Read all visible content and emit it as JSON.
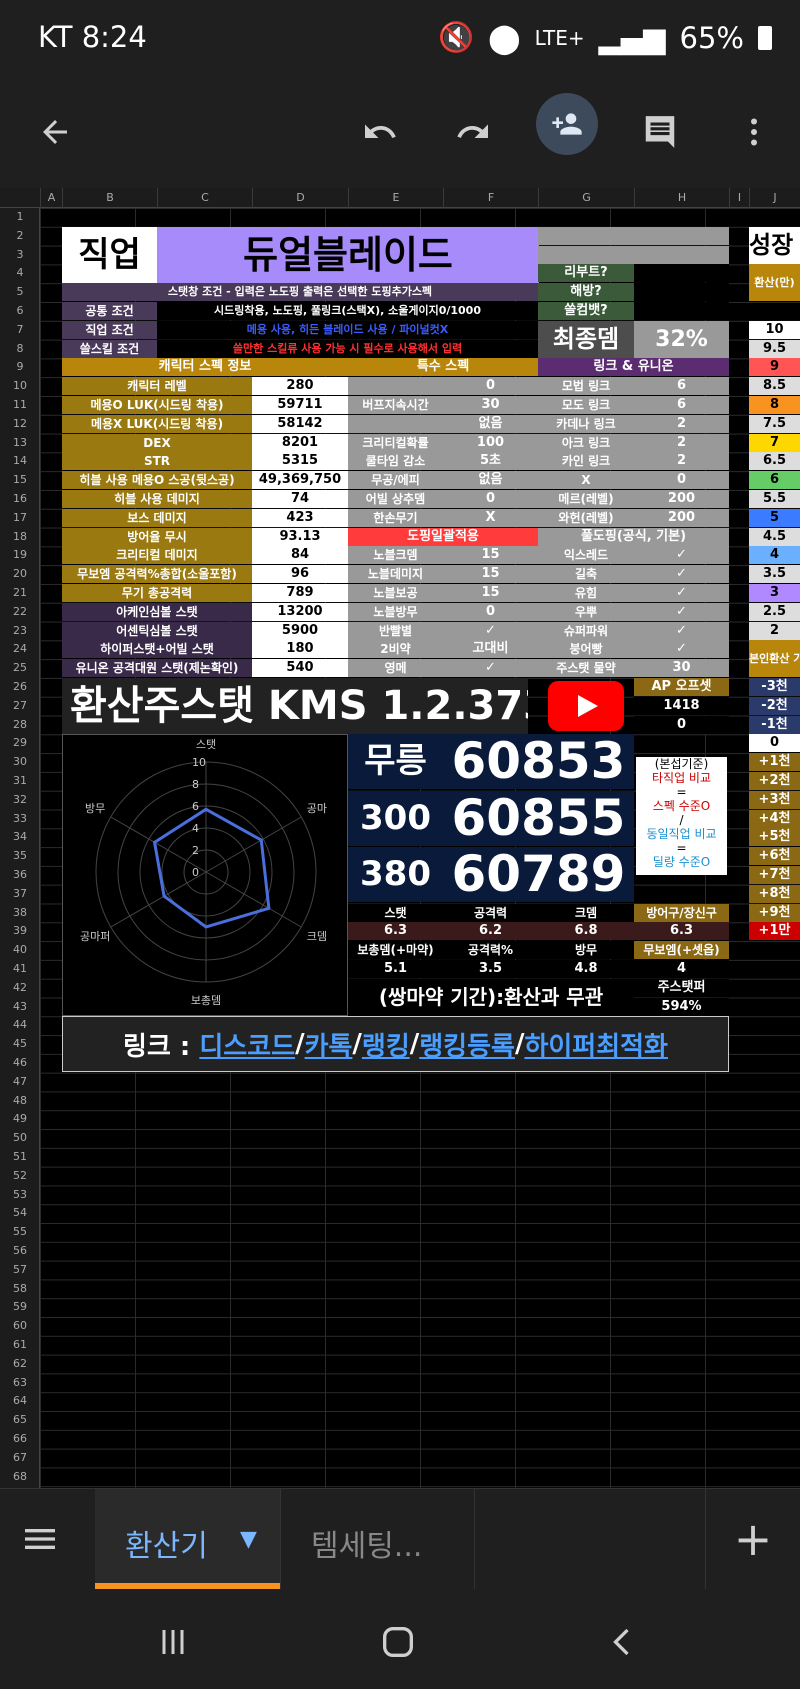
{
  "status": {
    "carrier_time": "KT 8:24",
    "battery": "65%",
    "network": "LTE+"
  },
  "toolbar": {
    "back": "back-arrow",
    "undo": "undo",
    "redo": "redo",
    "share": "add-person",
    "comment": "comment",
    "more": "more"
  },
  "columns": [
    "A",
    "B",
    "C",
    "D",
    "E",
    "F",
    "G",
    "H",
    "I",
    "J"
  ],
  "rows": [
    "1",
    "2",
    "3",
    "4",
    "5",
    "6",
    "7",
    "8",
    "9",
    "10",
    "11",
    "12",
    "13",
    "14",
    "15",
    "16",
    "17",
    "18",
    "19",
    "20",
    "21",
    "22",
    "23",
    "24",
    "25",
    "26",
    "27",
    "28",
    "29",
    "30",
    "31",
    "32",
    "33",
    "34",
    "35",
    "36",
    "37",
    "38",
    "39",
    "40",
    "41",
    "42",
    "43",
    "44",
    "45",
    "46",
    "47",
    "48",
    "49",
    "50",
    "51",
    "52",
    "53",
    "54",
    "55",
    "56",
    "57",
    "58",
    "59",
    "60",
    "61",
    "62",
    "63",
    "64",
    "65",
    "66",
    "67",
    "68"
  ],
  "header": {
    "job_label": "직업",
    "job_value": "듀얼블레이드",
    "reboot": "리부트?",
    "haebang": "해방?",
    "sseulbaek": "쓸컴뱃?",
    "final_dmg_label": "최종뎀",
    "final_dmg_value": "32%",
    "stat_cond": "스탯창 조건 - 입력은 노도핑 출력은 선택한 도핑추가스펙",
    "common_label": "공통 조건",
    "common_value": "시드링착용, 노도핑, 풀링크(스택X), 소울게이지0/1000",
    "job_cond_label": "직업 조건",
    "job_cond_value": "메용 사용, 히든 블레이드 사용 / 파이널컷X",
    "skill_label": "쓸스킬 조건",
    "skill_value": "쓸만한 스킬류 사용 가능 시 필수로 사용해서 입력"
  },
  "sections": {
    "char": "캐릭터 스펙 정보",
    "special": "특수 스펙",
    "link": "링크 & 유니온"
  },
  "left_rows": [
    {
      "k": "캐릭터 레벨",
      "v": "280"
    },
    {
      "k": "메용O LUK(시드링 착용)",
      "v": "59711"
    },
    {
      "k": "메용X LUK(시드링 착용)",
      "v": "58142"
    },
    {
      "k": "DEX",
      "v": "8201"
    },
    {
      "k": "STR",
      "v": "5315"
    },
    {
      "k": "히블 사용 메용O 스공(뒷스공)",
      "v": "49,369,750"
    },
    {
      "k": "히블 사용 데미지",
      "v": "74"
    },
    {
      "k": "보스 데미지",
      "v": "423"
    },
    {
      "k": "방어율 무시",
      "v": "93.13"
    },
    {
      "k": "크리티컬 데미지",
      "v": "84"
    },
    {
      "k": "무보엠 공격력%총합(소울포함)",
      "v": "96"
    },
    {
      "k": "무기 총공격력",
      "v": "789"
    },
    {
      "k": "아케인심볼 스탯",
      "v": "13200"
    },
    {
      "k": "어센틱심볼 스탯",
      "v": "5900"
    },
    {
      "k": "하이퍼스탯+어빌 스탯",
      "v": "180"
    },
    {
      "k": "유니온 공격대원 스탯(제논확인)",
      "v": "540"
    }
  ],
  "mid_rows": [
    {
      "k": "",
      "v": "0"
    },
    {
      "k": "버프지속시간",
      "v": "30"
    },
    {
      "k": "",
      "v": "없음"
    },
    {
      "k": "크리티컬확률",
      "v": "100"
    },
    {
      "k": "쿨타임 감소",
      "v": "5초"
    },
    {
      "k": "무공/에피",
      "v": "없음"
    },
    {
      "k": "어빌 상추뎀",
      "v": "0"
    },
    {
      "k": "한손무기",
      "v": "X"
    },
    {
      "k": "도핑일괄적용",
      "v": ""
    },
    {
      "k": "노블크뎀",
      "v": "15"
    },
    {
      "k": "노블데미지",
      "v": "15"
    },
    {
      "k": "노블보공",
      "v": "15"
    },
    {
      "k": "노블방무",
      "v": "0"
    },
    {
      "k": "반빨별",
      "v": "✓"
    },
    {
      "k": "2비약",
      "v": "고대비"
    },
    {
      "k": "영메",
      "v": "✓"
    }
  ],
  "right_rows": [
    {
      "k": "모법 링크",
      "v": "6"
    },
    {
      "k": "모도 링크",
      "v": "6"
    },
    {
      "k": "카데나 링크",
      "v": "2"
    },
    {
      "k": "아크 링크",
      "v": "2"
    },
    {
      "k": "카인 링크",
      "v": "2"
    },
    {
      "k": "X",
      "v": "0"
    },
    {
      "k": "메르(레벨)",
      "v": "200"
    },
    {
      "k": "와헌(레벨)",
      "v": "200"
    },
    {
      "k": "풀도핑(공식, 기본)",
      "v": ""
    },
    {
      "k": "익스레드",
      "v": "✓"
    },
    {
      "k": "길축",
      "v": "✓"
    },
    {
      "k": "유힘",
      "v": "✓"
    },
    {
      "k": "우뿌",
      "v": "✓"
    },
    {
      "k": "슈퍼파워",
      "v": "✓"
    },
    {
      "k": "붕어빵",
      "v": "✓"
    },
    {
      "k": "주스탯 물약",
      "v": "30"
    }
  ],
  "far_right": {
    "title": "성장",
    "sub": "환산(만)",
    "values": [
      "10",
      "9.5",
      "9",
      "8.5",
      "8",
      "7.5",
      "7",
      "6.5",
      "6",
      "5.5",
      "5",
      "4.5",
      "4",
      "3.5",
      "3",
      "2.5",
      "2"
    ],
    "note": "본인환산 기준+-",
    "deltas": [
      "-3천",
      "-2천",
      "-1천",
      "0",
      "+1천",
      "+2천",
      "+3천",
      "+4천",
      "+5천",
      "+6천",
      "+7천",
      "+8천",
      "+9천",
      "+1만"
    ]
  },
  "banner": {
    "title": "환산주스탯 KMS 1.2.373.2",
    "ap_offset_label": "AP 오프셋",
    "ap_offset_value": "1418",
    "zero": "0"
  },
  "radar": {
    "labels": [
      "스탯",
      "공마",
      "크뎀",
      "보총뎀",
      "공마퍼",
      "방무"
    ],
    "ticks": [
      "10",
      "8",
      "6",
      "4",
      "2",
      "0"
    ]
  },
  "results": [
    {
      "label": "무릉",
      "value": "60853"
    },
    {
      "label": "300",
      "value": "60855"
    },
    {
      "label": "380",
      "value": "60789"
    }
  ],
  "note": [
    "(본섭기준)",
    "타직업 비교",
    "=",
    "스펙 수준O",
    "/",
    "동일직업 비교",
    "=",
    "딜량 수준O"
  ],
  "eq_row1": {
    "labels": [
      "스탯",
      "공격력",
      "크뎀",
      "방어구/장신구"
    ],
    "values": [
      "6.3",
      "6.2",
      "6.8",
      "6.3"
    ]
  },
  "eq_row2": {
    "labels": [
      "보총뎀(+마약)",
      "공격력%",
      "방무",
      "무보엠(+셋옵)"
    ],
    "values": [
      "5.1",
      "3.5",
      "4.8",
      "4"
    ]
  },
  "bottom_note": "(쌍마약 기간):환산과 무관",
  "main_stat_pct_label": "주스탯퍼",
  "main_stat_pct": "594%",
  "links": {
    "prefix": "링크 : ",
    "items": [
      "디스코드",
      "카톡",
      "랭킹",
      "랭킹등록",
      "하이퍼최적화"
    ]
  },
  "tabs": {
    "active": "환산기",
    "other": "템세팅...",
    "add": "+"
  },
  "nav": [
    "recents",
    "home",
    "back"
  ]
}
